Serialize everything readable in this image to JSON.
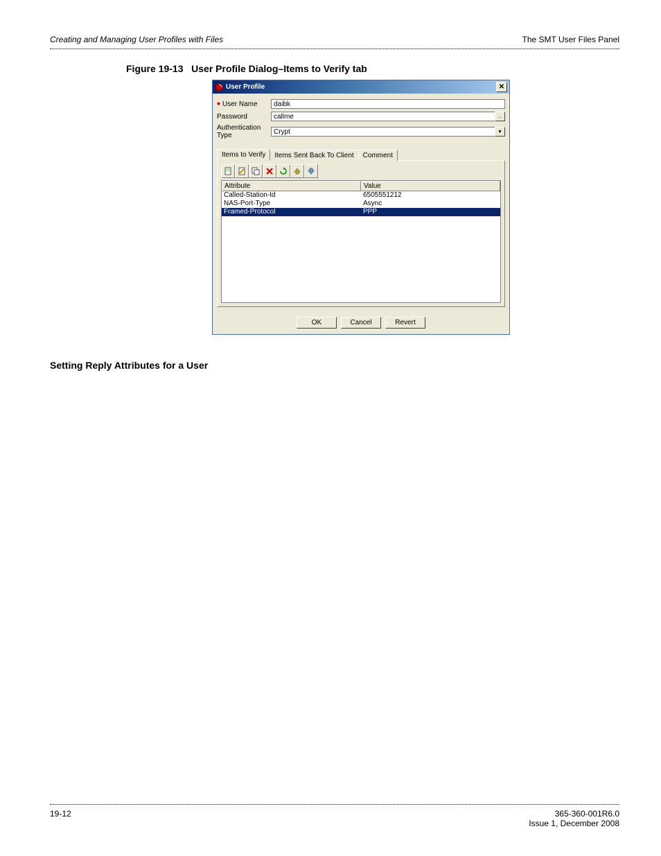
{
  "header": {
    "left": "Creating and Managing User Profiles with Files",
    "right": "The SMT User Files Panel"
  },
  "figure": {
    "label": "Figure 19-13",
    "title": "User Profile Dialog–Items to Verify tab"
  },
  "dialog": {
    "title": "User Profile",
    "close": "✕",
    "form": {
      "username_label": "User Name",
      "username_value": "daibk",
      "password_label": "Password",
      "password_value": "callme",
      "authtype_label": "Authentication Type",
      "authtype_value": "Crypt"
    },
    "tabs": {
      "t0": "Items to Verify",
      "t1": "Items Sent Back To Client",
      "t2": "Comment"
    },
    "grid": {
      "head_attr": "Attribute",
      "head_val": "Value",
      "rows": [
        {
          "attr": "Called-Station-Id",
          "val": "6505551212"
        },
        {
          "attr": "NAS-Port-Type",
          "val": "Async"
        },
        {
          "attr": "Framed-Protocol",
          "val": "PPP"
        }
      ]
    },
    "buttons": {
      "ok": "OK",
      "cancel": "Cancel",
      "revert": "Revert"
    }
  },
  "section_heading": "Setting Reply Attributes for a User",
  "footer": {
    "page": "19-12",
    "doc": "365-360-001R6.0",
    "issue": "Issue 1, December 2008"
  }
}
